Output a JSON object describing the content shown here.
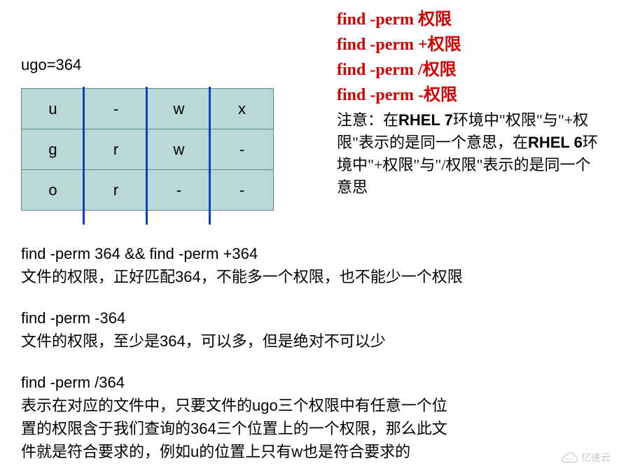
{
  "ugoLabel": "ugo=364",
  "permTable": [
    [
      "u",
      "-",
      "w",
      "x"
    ],
    [
      "g",
      "r",
      "w",
      "-"
    ],
    [
      "o",
      "r",
      "-",
      "-"
    ]
  ],
  "syntaxLines": [
    {
      "cmd": "find  -perm  ",
      "arg": "权限"
    },
    {
      "cmd": "find  -perm  ",
      "arg": "+权限"
    },
    {
      "cmd": "find  -perm  ",
      "arg": "/权限"
    },
    {
      "cmd": "find  -perm  ",
      "arg": "-权限"
    }
  ],
  "note": {
    "part1": "注意：在",
    "rhel7": "RHEL 7",
    "part2": "环境中\"权限\"与\"+权限\"表示的是同一个意思，在",
    "rhel6": "RHEL 6",
    "part3": "环境中\"+权限\"与\"/权限\"表示的是同一个意思"
  },
  "sections": [
    {
      "cmd": "find -perm 364 && find -perm +364",
      "desc": "文件的权限，正好匹配364，不能多一个权限，也不能少一个权限"
    },
    {
      "cmd": "find -perm -364",
      "desc": "文件的权限，至少是364，可以多，但是绝对不可以少"
    },
    {
      "cmd": "find -perm /364",
      "desc": "表示在对应的文件中，只要文件的ugo三个权限中有任意一个位置的权限含于我们查询的364三个位置上的一个权限，那么此文件就是符合要求的，例如u的位置上只有w也是符合要求的"
    }
  ],
  "watermark": "亿速云"
}
